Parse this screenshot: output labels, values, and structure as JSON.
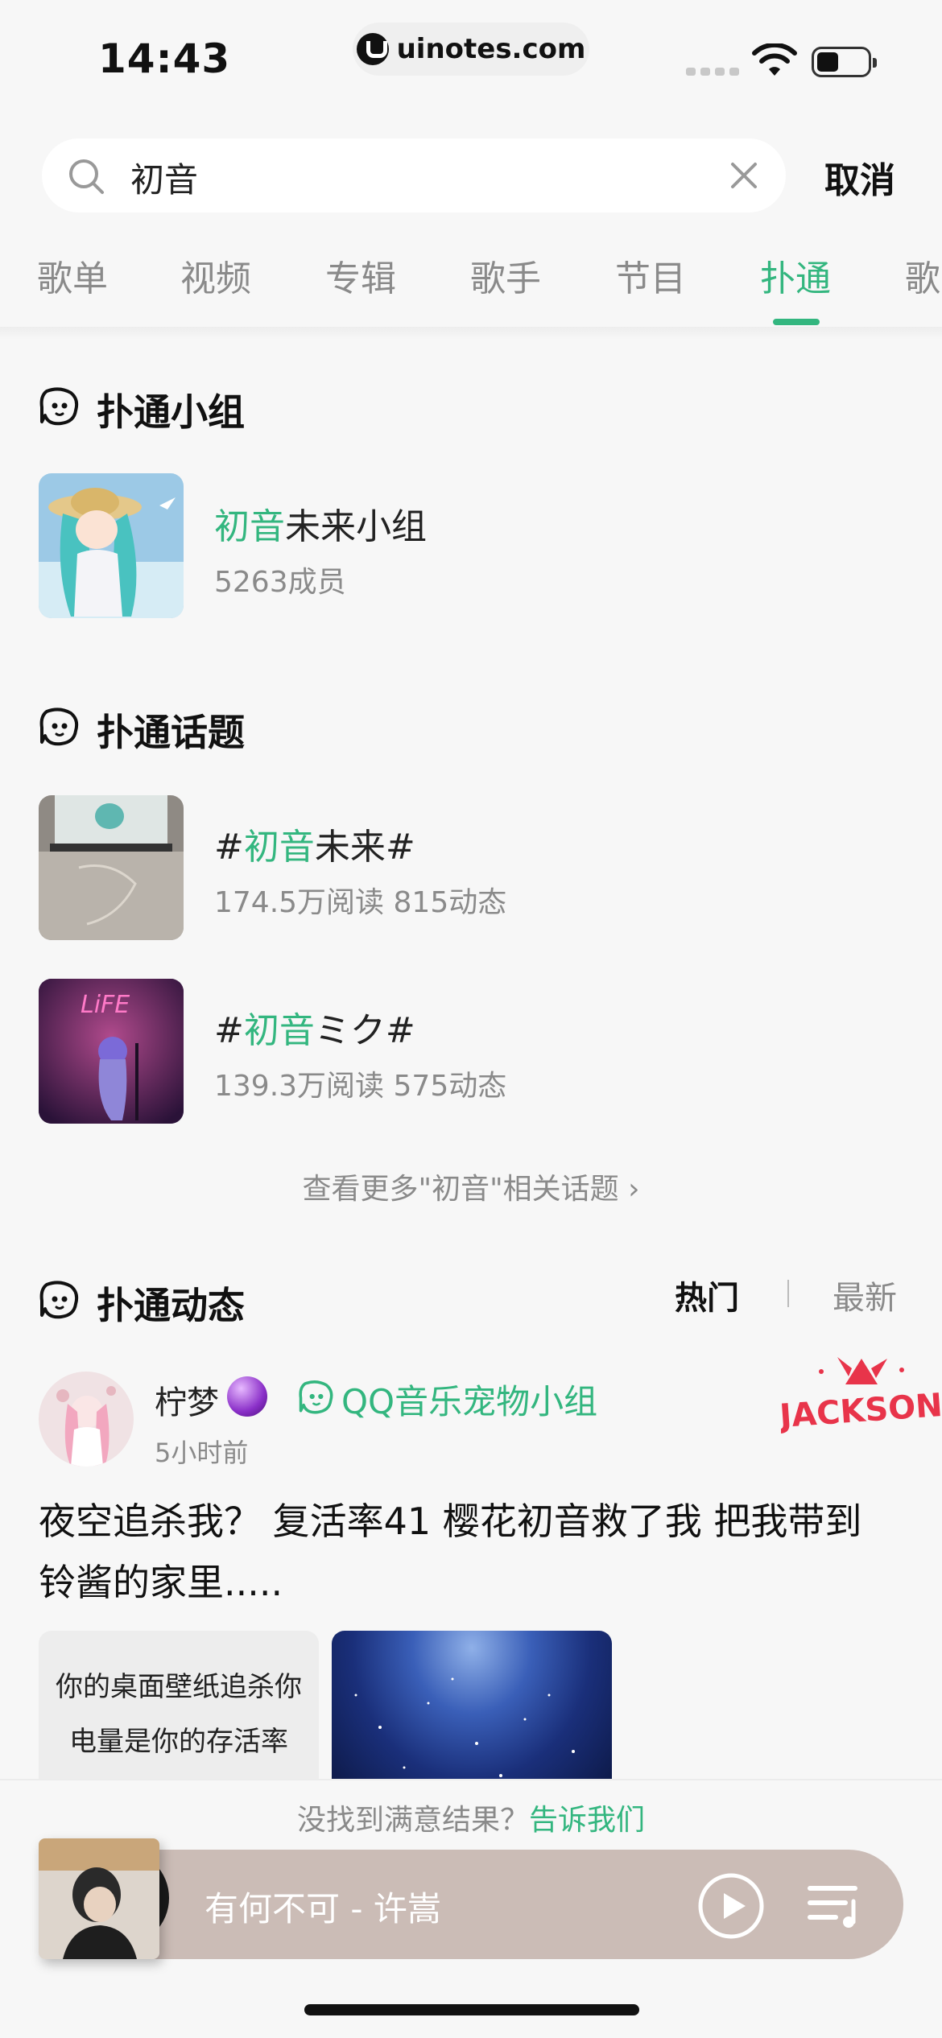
{
  "status_bar": {
    "time": "14:43",
    "url": "uinotes.com"
  },
  "search": {
    "query": "初音",
    "cancel_label": "取消"
  },
  "tabs": [
    {
      "label": "歌单",
      "active": false
    },
    {
      "label": "视频",
      "active": false
    },
    {
      "label": "专辑",
      "active": false
    },
    {
      "label": "歌手",
      "active": false
    },
    {
      "label": "节目",
      "active": false
    },
    {
      "label": "扑通",
      "active": true
    },
    {
      "label": "歌",
      "active": false
    }
  ],
  "groups_section": {
    "title": "扑通小组",
    "items": [
      {
        "name_highlight": "初音",
        "name_rest": "未来小组",
        "members": "5263成员"
      }
    ]
  },
  "topics_section": {
    "title": "扑通话题",
    "items": [
      {
        "prefix": "#",
        "highlight": "初音",
        "rest": "未来#",
        "stats": "174.5万阅读 815动态"
      },
      {
        "prefix": "#",
        "highlight": "初音",
        "rest": "ミク#",
        "stats": "139.3万阅读 575动态"
      }
    ],
    "more_link": "查看更多\"初音\"相关话题"
  },
  "feed_section": {
    "title": "扑通动态",
    "sort_hot": "热门",
    "sort_new": "最新",
    "post": {
      "user": "柠梦",
      "group": "QQ音乐宠物小组",
      "time": "5小时前",
      "text": "夜空追杀我？ 复活率41  樱花初音救了我 把我带到铃酱的家里.....",
      "image_caption_line1": "你的桌面壁纸追杀你",
      "image_caption_line2": "电量是你的存活率",
      "logo_text": "JACKSON"
    }
  },
  "feedback": {
    "text": "没找到满意结果？",
    "link": "告诉我们"
  },
  "player": {
    "song": "有何不可 - 许嵩",
    "play_state": "paused"
  },
  "colors": {
    "accent": "#33b67f",
    "player_bg": "#cbbcb6"
  }
}
